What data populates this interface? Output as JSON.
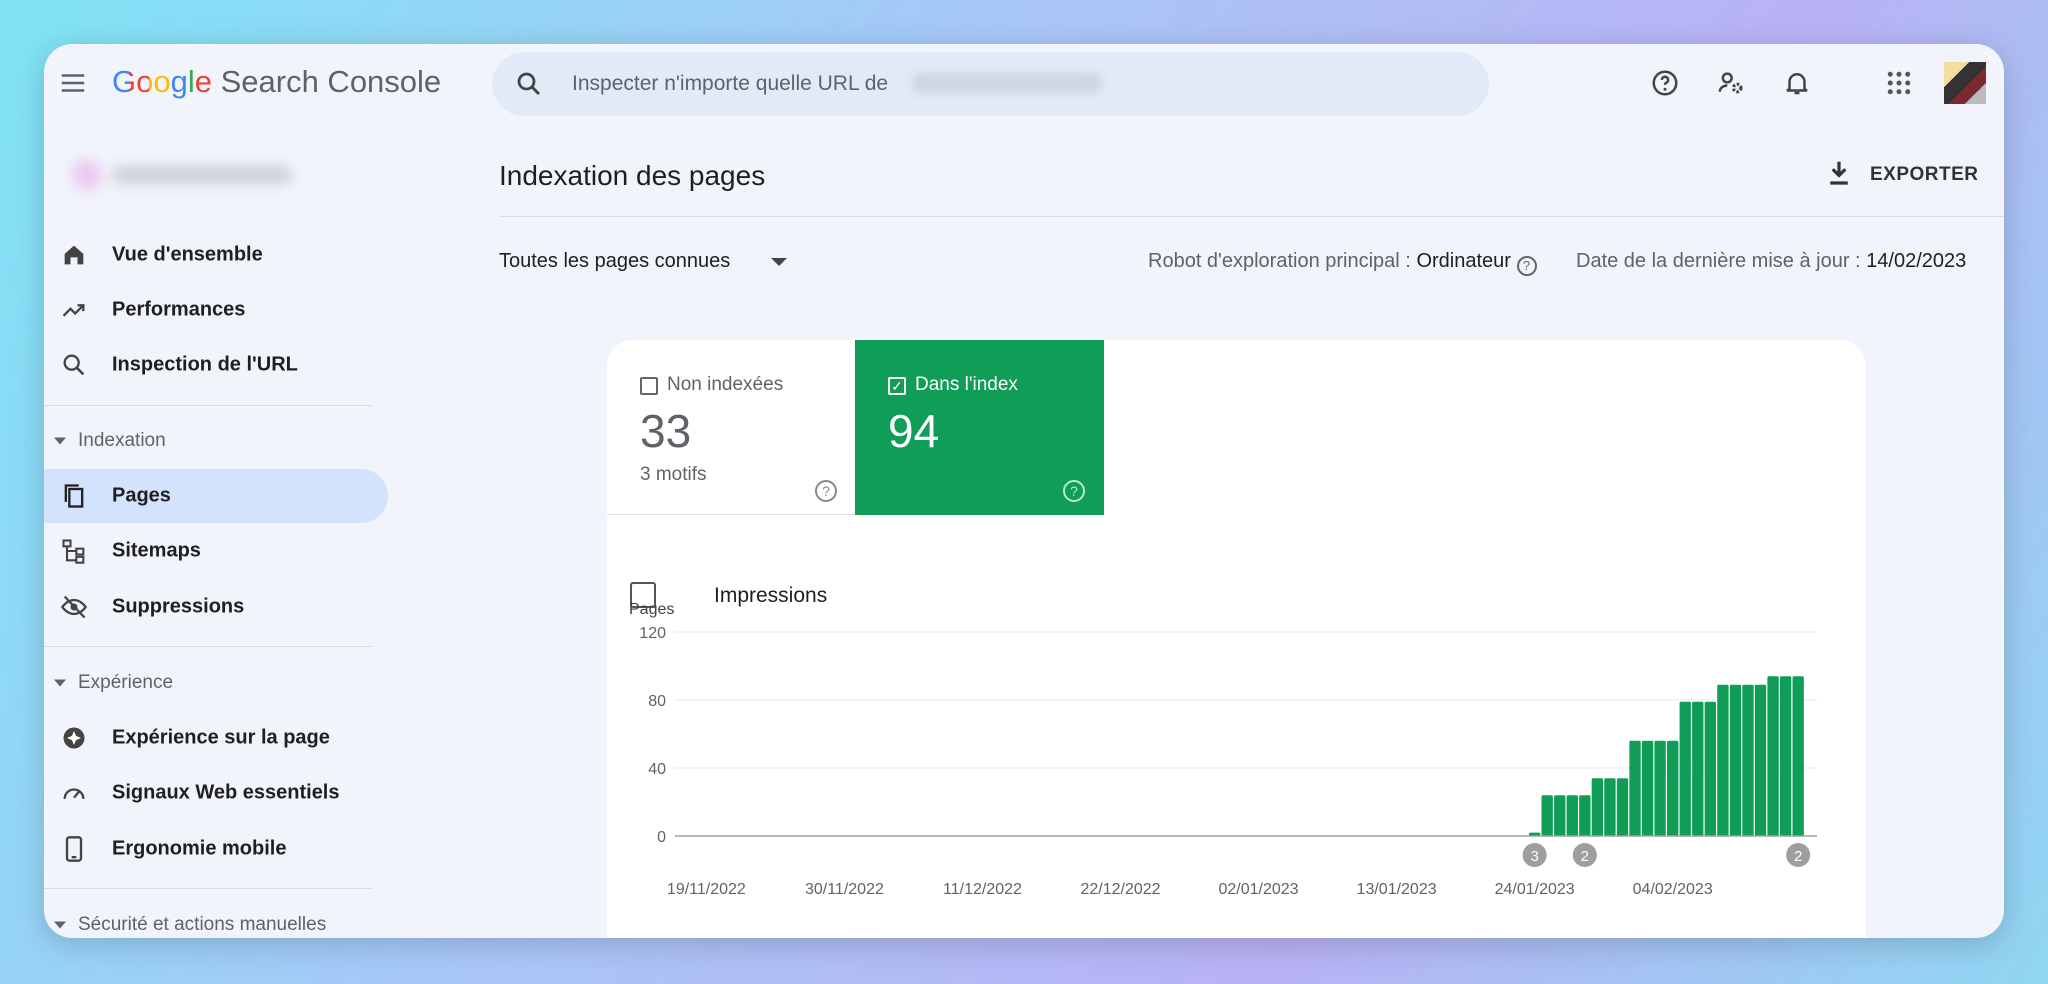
{
  "header": {
    "app_title_brand": "Google",
    "app_title": "Search Console",
    "search_placeholder": "Inspecter n'importe quelle URL de",
    "icons": [
      "menu-icon",
      "search-icon",
      "help-icon",
      "manage-users-icon",
      "bell-icon",
      "apps-grid-icon",
      "avatar"
    ]
  },
  "sidebar": {
    "items": [
      {
        "label": "Vue d'ensemble",
        "icon": "home-icon"
      },
      {
        "label": "Performances",
        "icon": "trending-up-icon"
      },
      {
        "label": "Inspection de l'URL",
        "icon": "search-icon"
      }
    ],
    "sections": [
      {
        "label": "Indexation",
        "items": [
          {
            "label": "Pages",
            "icon": "pages-icon",
            "active": true
          },
          {
            "label": "Sitemaps",
            "icon": "sitemap-icon"
          },
          {
            "label": "Suppressions",
            "icon": "eye-off-icon"
          }
        ]
      },
      {
        "label": "Expérience",
        "items": [
          {
            "label": "Expérience sur la page",
            "icon": "star-badge-icon"
          },
          {
            "label": "Signaux Web essentiels",
            "icon": "speed-gauge-icon"
          },
          {
            "label": "Ergonomie mobile",
            "icon": "phone-icon"
          }
        ]
      },
      {
        "label": "Sécurité et actions manuelles",
        "items": []
      }
    ]
  },
  "main": {
    "title": "Indexation des pages",
    "export_label": "EXPORTER",
    "filter_value": "Toutes les pages connues",
    "crawler_label": "Robot d'exploration principal :",
    "crawler_value": "Ordinateur",
    "updated_label": "Date de la dernière mise à jour :",
    "updated_value": "14/02/2023",
    "tiles": [
      {
        "label": "Non indexées",
        "value": "33",
        "sub": "3 motifs",
        "checked": false
      },
      {
        "label": "Dans l'index",
        "value": "94",
        "checked": true,
        "color": "#0f9d58"
      }
    ],
    "impressions_label": "Impressions"
  },
  "chart_data": {
    "type": "bar",
    "ylabel": "Pages",
    "ylim": [
      0,
      120
    ],
    "yticks": [
      "0",
      "40",
      "80",
      "120"
    ],
    "x_range": [
      "17/11/2022",
      "14/02/2023"
    ],
    "xticks": [
      "19/11/2022",
      "30/11/2022",
      "11/12/2022",
      "22/12/2022",
      "02/01/2023",
      "13/01/2023",
      "24/01/2023",
      "04/02/2023"
    ],
    "grid": true,
    "color": "#0f9d58",
    "series": [
      {
        "note_default_value": 0,
        "points": [
          [
            "24/01/2023",
            2
          ],
          [
            "25/01/2023",
            24
          ],
          [
            "26/01/2023",
            24
          ],
          [
            "27/01/2023",
            24
          ],
          [
            "28/01/2023",
            24
          ],
          [
            "29/01/2023",
            34
          ],
          [
            "30/01/2023",
            34
          ],
          [
            "31/01/2023",
            34
          ],
          [
            "01/02/2023",
            56
          ],
          [
            "02/02/2023",
            56
          ],
          [
            "03/02/2023",
            56
          ],
          [
            "04/02/2023",
            56
          ],
          [
            "05/02/2023",
            79
          ],
          [
            "06/02/2023",
            79
          ],
          [
            "07/02/2023",
            79
          ],
          [
            "08/02/2023",
            89
          ],
          [
            "09/02/2023",
            89
          ],
          [
            "10/02/2023",
            89
          ],
          [
            "11/02/2023",
            89
          ],
          [
            "12/02/2023",
            94
          ],
          [
            "13/02/2023",
            94
          ],
          [
            "14/02/2023",
            94
          ]
        ]
      }
    ],
    "annotations": [
      {
        "date": "24/01/2023",
        "label": "3"
      },
      {
        "date": "28/01/2023",
        "label": "2"
      },
      {
        "date": "14/02/2023",
        "label": "2"
      }
    ]
  }
}
